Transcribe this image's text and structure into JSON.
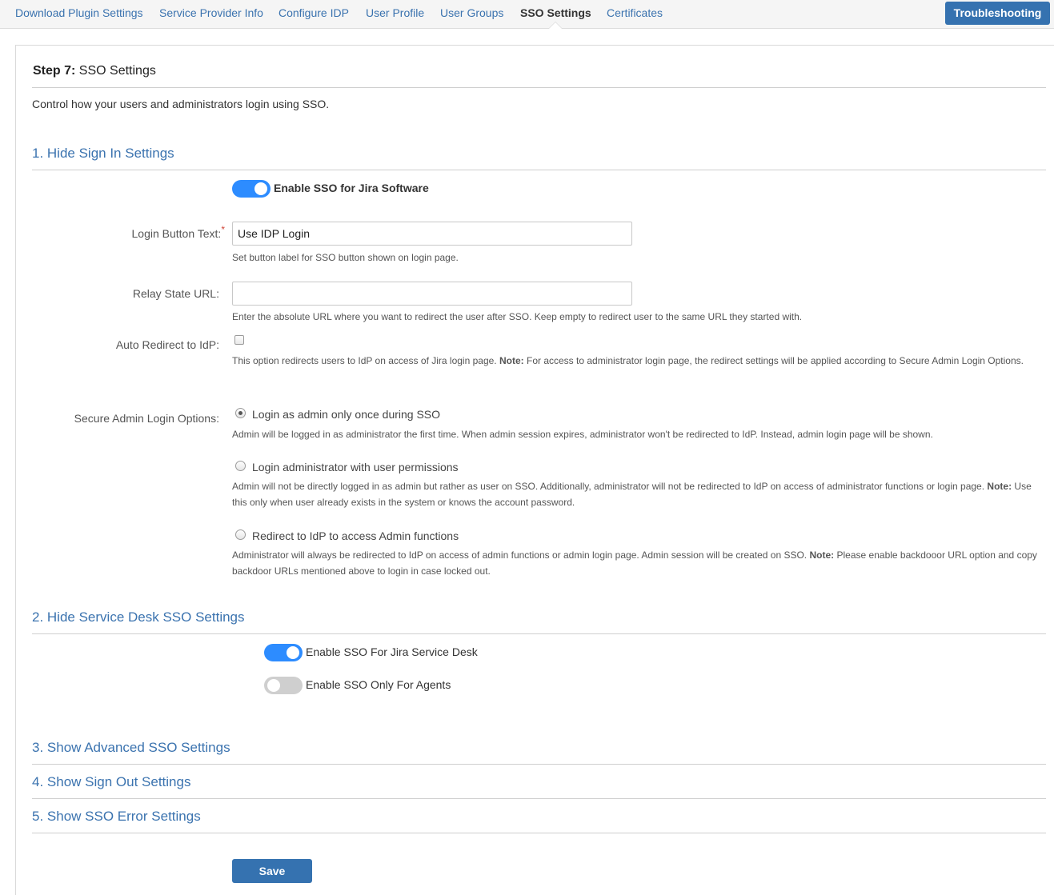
{
  "nav": {
    "tabs": [
      {
        "label": "Download Plugin Settings"
      },
      {
        "label": "Service Provider Info"
      },
      {
        "label": "Configure IDP"
      },
      {
        "label": "User Profile"
      },
      {
        "label": "User Groups"
      },
      {
        "label": "SSO Settings",
        "active": true
      },
      {
        "label": "Certificates"
      }
    ],
    "troubleshooting_label": "Troubleshooting"
  },
  "page": {
    "step_prefix": "Step 7:",
    "step_title": "SSO Settings",
    "description": "Control how your users and administrators login using SSO."
  },
  "sections": {
    "hide_sign_in": "1. Hide Sign In Settings",
    "hide_service_desk": "2. Hide Service Desk SSO Settings",
    "show_advanced": "3. Show Advanced SSO Settings",
    "show_sign_out": "4. Show Sign Out Settings",
    "show_error": "5. Show SSO Error Settings"
  },
  "sign_in": {
    "enable_sso_label": "Enable SSO for Jira Software",
    "enable_sso_on": true,
    "login_button_text_label": "Login Button Text:",
    "required_marker": "*",
    "login_button_text_value": "Use IDP Login",
    "login_button_text_help": "Set button label for SSO button shown on login page.",
    "relay_state_label": "Relay State URL:",
    "relay_state_value": "",
    "relay_state_help": "Enter the absolute URL where you want to redirect the user after SSO. Keep empty to redirect user to the same URL they started with.",
    "auto_redirect_label": "Auto Redirect to IdP:",
    "auto_redirect_checked": false,
    "auto_redirect_help_pre": "This option redirects users to IdP on access of Jira login page.",
    "auto_redirect_help_note": "Note:",
    "auto_redirect_help_post": "For access to administrator login page, the redirect settings will be applied according to Secure Admin Login Options.",
    "secure_admin_label": "Secure Admin Login Options:",
    "admin_options": [
      {
        "label": "Login as admin only once during SSO",
        "checked": true,
        "help_pre": "Admin will be logged in as administrator the first time. When admin session expires, administrator won't be redirected to IdP. Instead, admin login page will be shown.",
        "help_note": "",
        "help_post": ""
      },
      {
        "label": "Login administrator with user permissions",
        "checked": false,
        "help_pre": "Admin will not be directly logged in as admin but rather as user on SSO. Additionally, administrator will not be redirected to IdP on access of administrator functions or login page.",
        "help_note": "Note:",
        "help_post": "Use this only when user already exists in the system or knows the account password."
      },
      {
        "label": "Redirect to IdP to access Admin functions",
        "checked": false,
        "help_pre": "Administrator will always be redirected to IdP on access of admin functions or admin login page. Admin session will be created on SSO.",
        "help_note": "Note:",
        "help_post": "Please enable backdooor URL option and copy backdoor URLs mentioned above to login in case locked out."
      }
    ]
  },
  "service_desk": {
    "enable_sd_label": "Enable SSO For Jira Service Desk",
    "enable_sd_on": true,
    "agents_only_label": "Enable SSO Only For Agents",
    "agents_only_on": false
  },
  "save_label": "Save",
  "colors": {
    "link": "#3b73af",
    "primary_button": "#3572b0",
    "toggle_on": "#2d8cff",
    "toggle_off": "#cfcfcf"
  }
}
